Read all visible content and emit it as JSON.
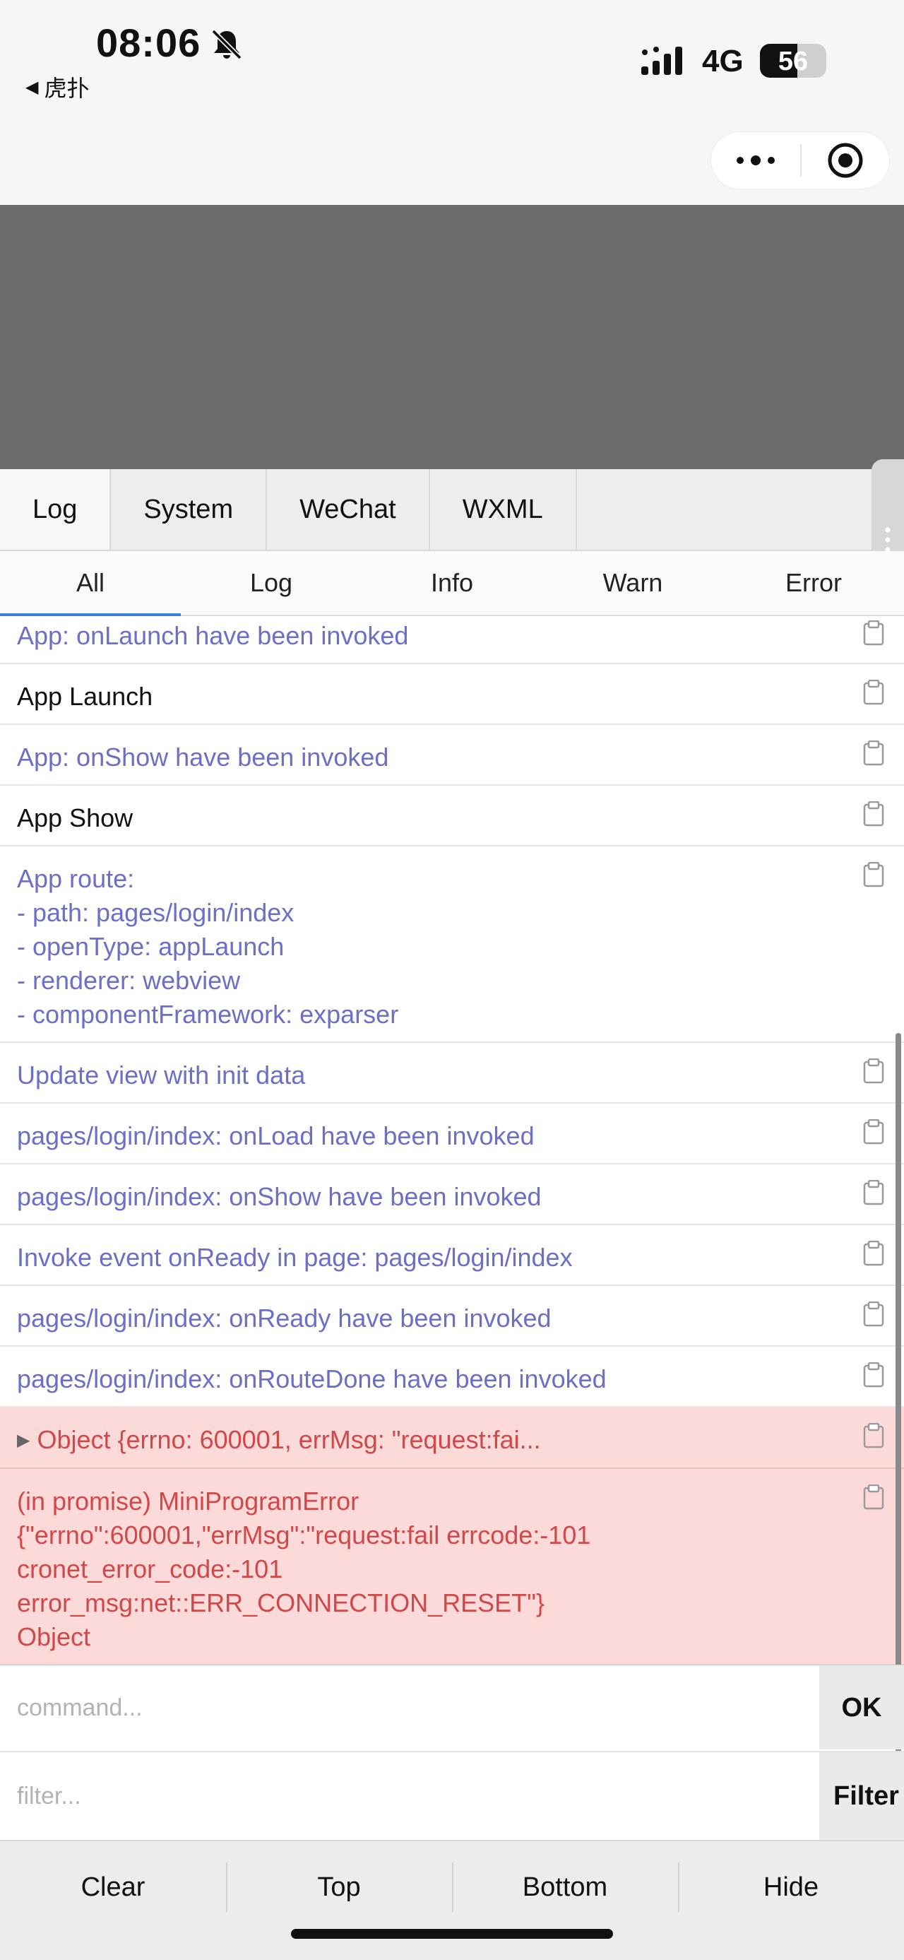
{
  "status_bar": {
    "time": "08:06",
    "back_app": "虎扑",
    "network": "4G",
    "battery": "56",
    "battery_level": 0.56
  },
  "capsule": {
    "more_icon": "more-dots-icon",
    "close_icon": "target-circle-icon"
  },
  "tabs": [
    {
      "label": "Log",
      "active": true
    },
    {
      "label": "System",
      "active": false
    },
    {
      "label": "WeChat",
      "active": false
    },
    {
      "label": "WXML",
      "active": false
    }
  ],
  "filters": [
    {
      "label": "All",
      "active": true
    },
    {
      "label": "Log",
      "active": false
    },
    {
      "label": "Info",
      "active": false
    },
    {
      "label": "Warn",
      "active": false
    },
    {
      "label": "Error",
      "active": false
    }
  ],
  "logs": [
    {
      "text": "App: onLaunch have been invoked",
      "kind": "system"
    },
    {
      "text": "App Launch",
      "kind": "log"
    },
    {
      "text": "App: onShow have been invoked",
      "kind": "system"
    },
    {
      "text": "App Show",
      "kind": "log"
    },
    {
      "text": "App route:\n- path: pages/login/index\n- openType: appLaunch\n- renderer: webview\n- componentFramework: exparser",
      "kind": "system"
    },
    {
      "text": "Update view with init data",
      "kind": "system"
    },
    {
      "text": "pages/login/index: onLoad have been invoked",
      "kind": "system"
    },
    {
      "text": "pages/login/index: onShow have been invoked",
      "kind": "system"
    },
    {
      "text": "Invoke event onReady in page: pages/login/index",
      "kind": "system"
    },
    {
      "text": "pages/login/index: onReady have been invoked",
      "kind": "system"
    },
    {
      "text": "pages/login/index: onRouteDone have been invoked",
      "kind": "system"
    },
    {
      "text": "Object {errno: 600001, errMsg: \"request:fai...",
      "kind": "error",
      "collapsible": true
    },
    {
      "text": "(in promise) MiniProgramError\n{\"errno\":600001,\"errMsg\":\"request:fail errcode:-101\ncronet_error_code:-101\nerror_msg:net::ERR_CONNECTION_RESET\"}\nObject",
      "kind": "error"
    }
  ],
  "command": {
    "placeholder": "command...",
    "button": "OK"
  },
  "filter_input": {
    "placeholder": "filter...",
    "button": "Filter"
  },
  "toolbar": [
    "Clear",
    "Top",
    "Bottom",
    "Hide"
  ],
  "colors": {
    "system_text": "#6b6fc7",
    "error_text": "#d14848",
    "error_bg": "#fddada",
    "active_underline": "#3d7fe0"
  }
}
